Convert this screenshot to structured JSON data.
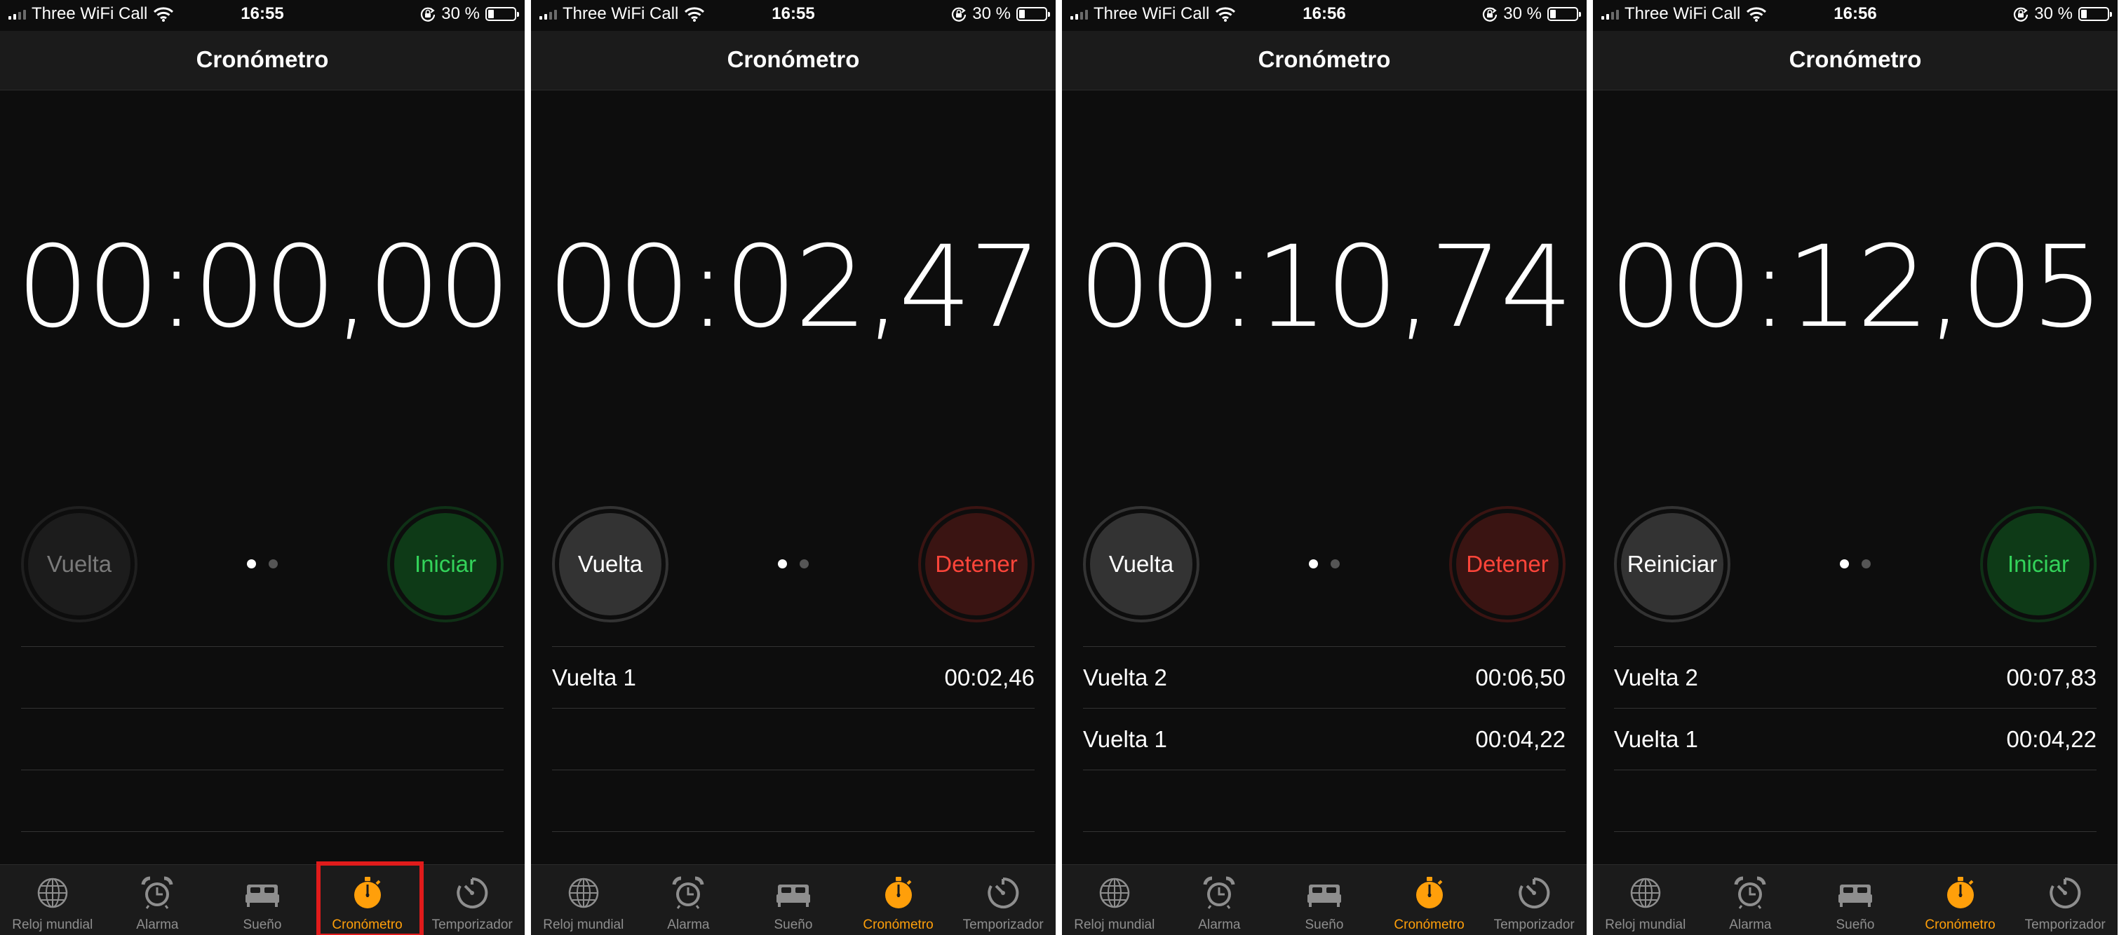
{
  "colors": {
    "background": "#0d0d0d",
    "bar": "#1b1b1b",
    "green_text": "#33d35a",
    "red_text": "#ff453a",
    "active_tab": "#ff9f0a",
    "inactive_tab": "#8e8e8e",
    "highlight_box": "#e01b1b"
  },
  "tabs": [
    {
      "label": "Reloj mundial",
      "icon": "globe-icon"
    },
    {
      "label": "Alarma",
      "icon": "alarm-clock-icon"
    },
    {
      "label": "Sueño",
      "icon": "bed-icon"
    },
    {
      "label": "Cronómetro",
      "icon": "stopwatch-icon"
    },
    {
      "label": "Temporizador",
      "icon": "timer-icon"
    }
  ],
  "screens": [
    {
      "status": {
        "carrier": "Three WiFi Call",
        "time": "16:55",
        "battery": "30 %"
      },
      "title": "Cronómetro",
      "display": "00:00,00",
      "left_button": {
        "label": "Vuelta",
        "state": "disabled"
      },
      "right_button": {
        "label": "Iniciar",
        "color": "green"
      },
      "laps": [],
      "active_tab": 3,
      "tab_highlighted": true
    },
    {
      "status": {
        "carrier": "Three WiFi Call",
        "time": "16:55",
        "battery": "30 %"
      },
      "title": "Cronómetro",
      "display": "00:02,47",
      "left_button": {
        "label": "Vuelta",
        "state": "enabled"
      },
      "right_button": {
        "label": "Detener",
        "color": "red"
      },
      "laps": [
        {
          "name": "Vuelta 1",
          "time": "00:02,46"
        }
      ],
      "active_tab": 3,
      "tab_highlighted": false
    },
    {
      "status": {
        "carrier": "Three WiFi Call",
        "time": "16:56",
        "battery": "30 %"
      },
      "title": "Cronómetro",
      "display": "00:10,74",
      "left_button": {
        "label": "Vuelta",
        "state": "enabled"
      },
      "right_button": {
        "label": "Detener",
        "color": "red"
      },
      "laps": [
        {
          "name": "Vuelta 2",
          "time": "00:06,50"
        },
        {
          "name": "Vuelta 1",
          "time": "00:04,22"
        }
      ],
      "active_tab": 3,
      "tab_highlighted": false
    },
    {
      "status": {
        "carrier": "Three WiFi Call",
        "time": "16:56",
        "battery": "30 %"
      },
      "title": "Cronómetro",
      "display": "00:12,05",
      "left_button": {
        "label": "Reiniciar",
        "state": "enabled"
      },
      "right_button": {
        "label": "Iniciar",
        "color": "green"
      },
      "laps": [
        {
          "name": "Vuelta 2",
          "time": "00:07,83"
        },
        {
          "name": "Vuelta 1",
          "time": "00:04,22"
        }
      ],
      "active_tab": 3,
      "tab_highlighted": false
    }
  ]
}
